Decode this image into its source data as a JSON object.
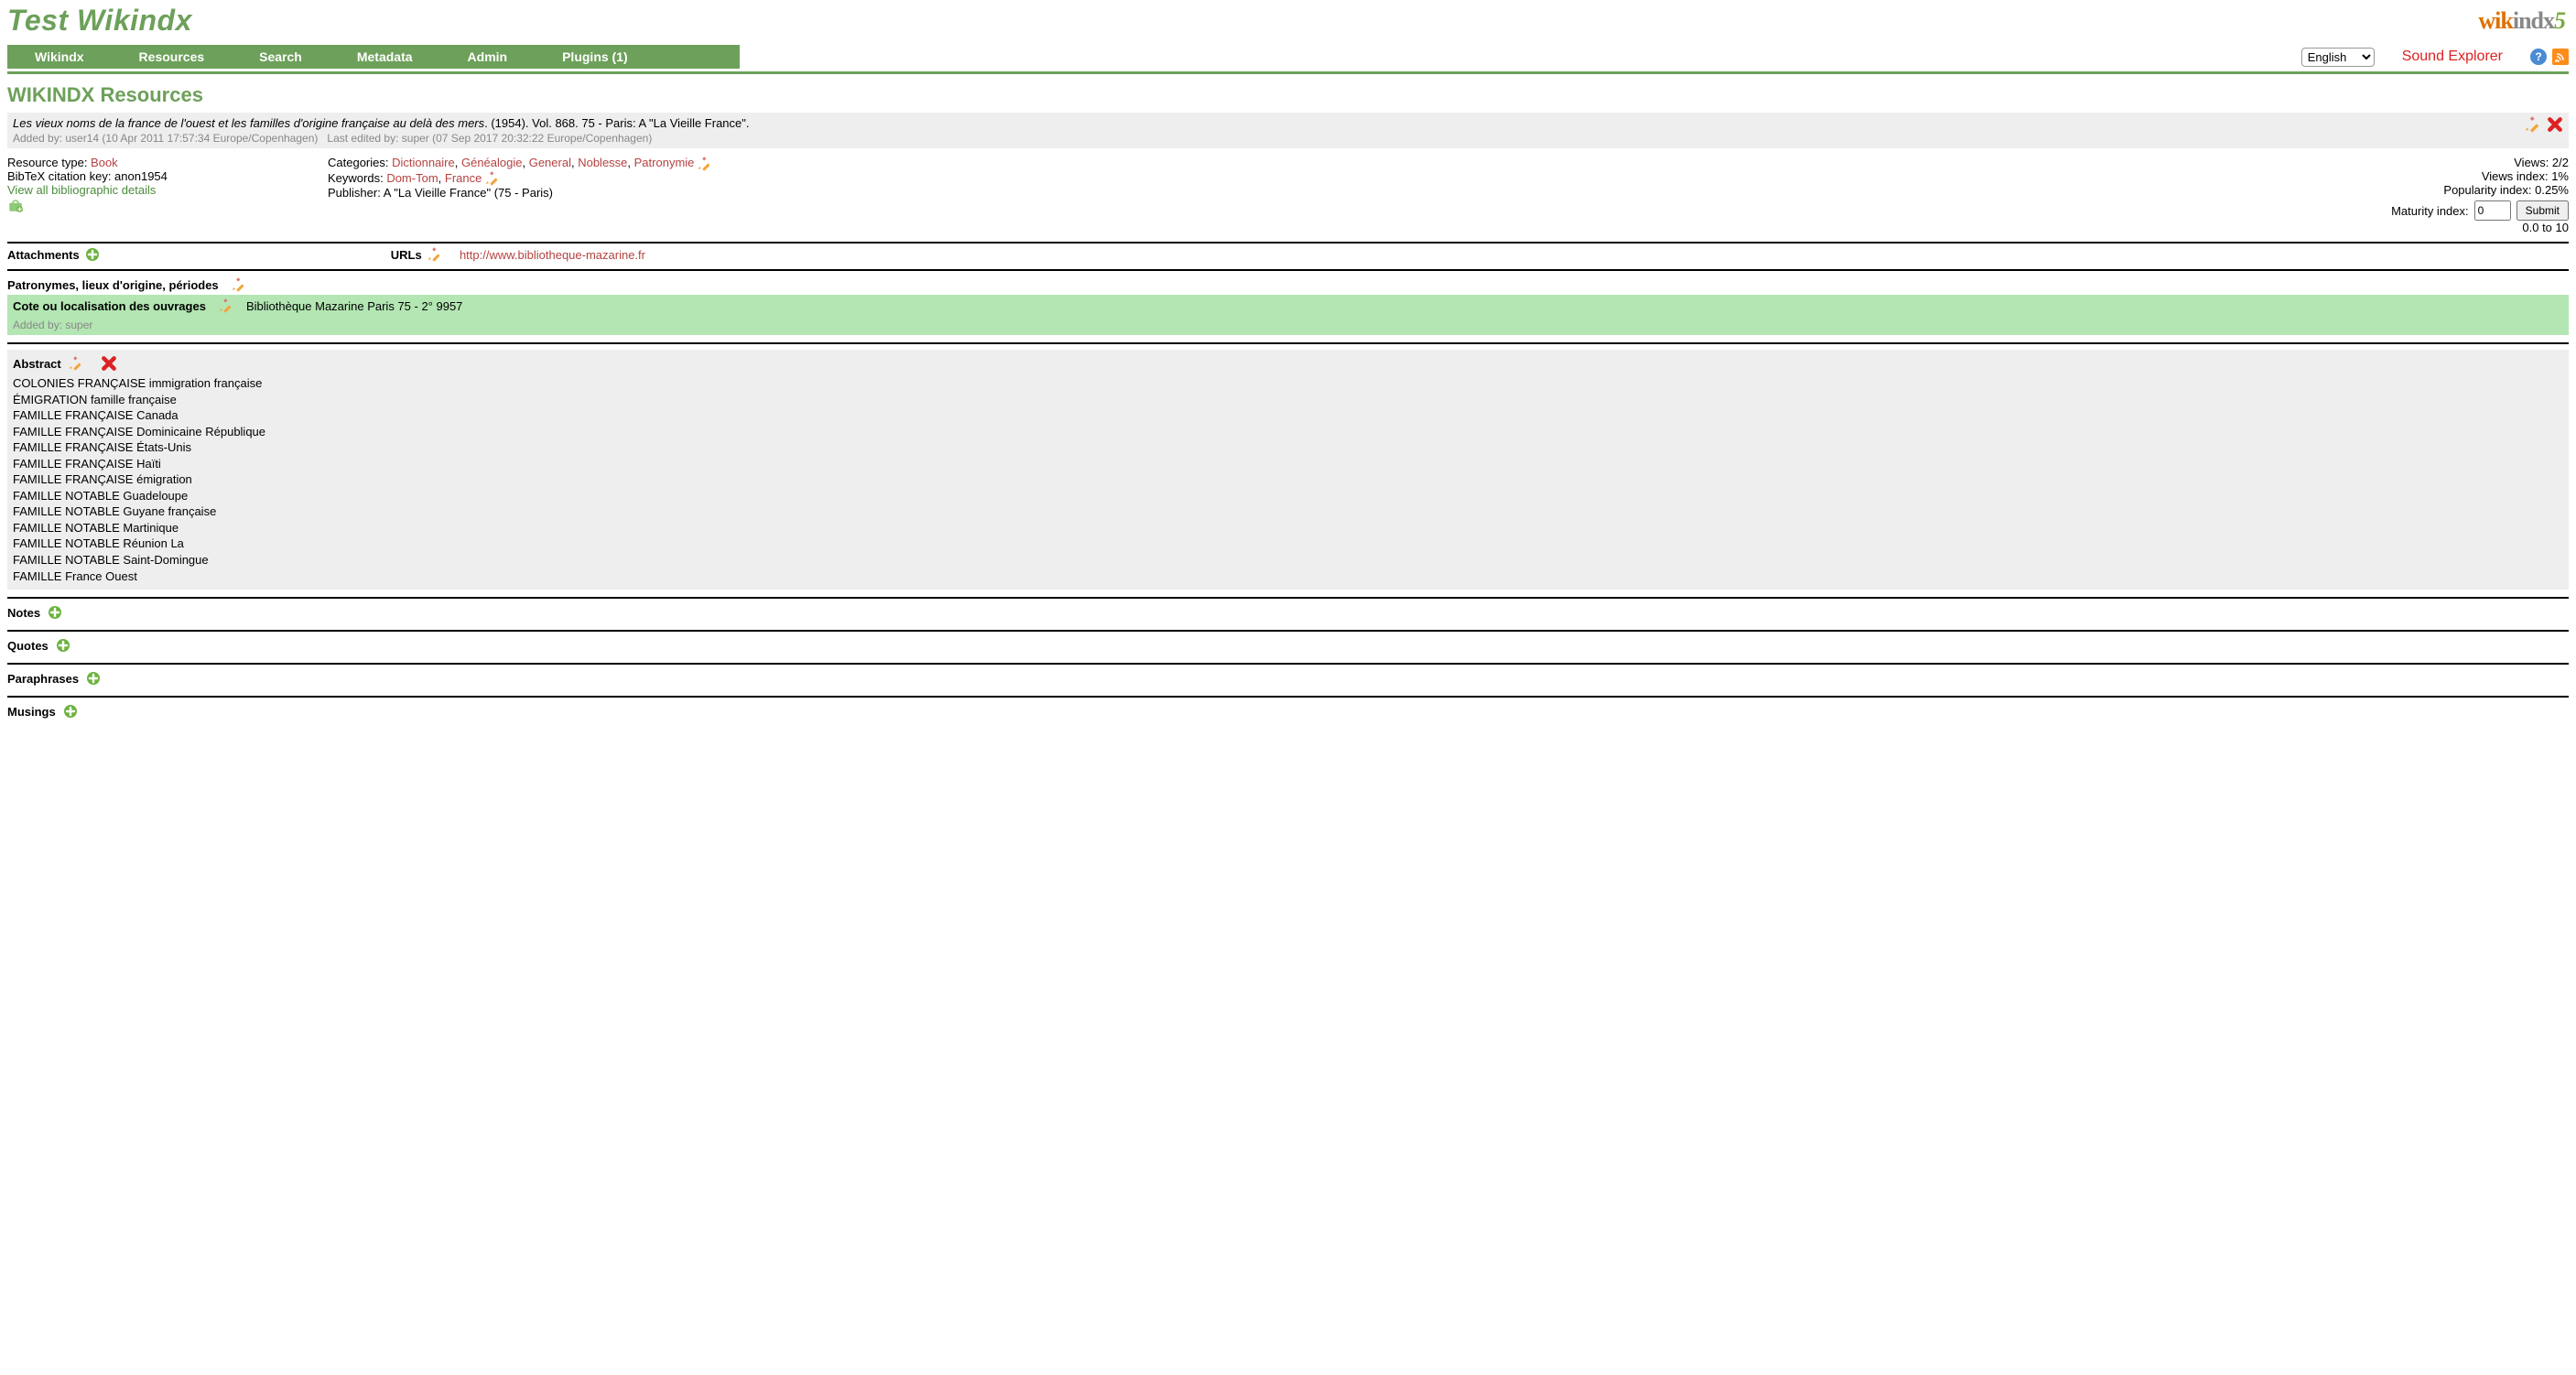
{
  "site_title": "Test Wikindx",
  "logo": {
    "part1": "wik",
    "part2": "indx",
    "part3": "5"
  },
  "menu": [
    "Wikindx",
    "Resources",
    "Search",
    "Metadata",
    "Admin",
    "Plugins (1)"
  ],
  "language_selected": "English",
  "sound_explorer": "Sound Explorer",
  "page_heading": "WIKINDX Resources",
  "citation": {
    "title": "Les vieux noms de la france de l'ouest et les familles d'origine française au delà des mers",
    "rest": ". (1954). Vol. 868. 75 - Paris: A \"La Vieille France\".",
    "added_by": "Added by: user14 (10 Apr 2011 17:57:34 Europe/Copenhagen)",
    "last_edited": "Last edited by: super (07 Sep 2017 20:32:22 Europe/Copenhagen)"
  },
  "details": {
    "resource_type_label": "Resource type: ",
    "resource_type": "Book",
    "bibtex_label": "BibTeX citation key: anon1954",
    "view_all": "View all bibliographic details",
    "categories_label": "Categories: ",
    "categories": [
      "Dictionnaire",
      "Généalogie",
      "General",
      "Noblesse",
      "Patronymie"
    ],
    "keywords_label": "Keywords: ",
    "keywords": [
      "Dom-Tom",
      "France"
    ],
    "publisher_label": "Publisher: A \"La Vieille France\" (75 - Paris)",
    "views": "Views: 2/2",
    "views_index": "Views index: 1%",
    "popularity": "Popularity index: 0.25%",
    "maturity_label": "Maturity index:",
    "maturity_value": "0",
    "submit": "Submit",
    "maturity_range": "0.0 to 10"
  },
  "attachments_label": "Attachments",
  "urls_label": "URLs",
  "url": "http://www.bibliotheque-mazarine.fr",
  "patro_label": "Patronymes, lieux d'origine, périodes",
  "cote_label": "Cote ou localisation des ouvrages",
  "cote_value": "Bibliothèque Mazarine Paris 75 - 2° 9957",
  "cote_added_by": "Added by: super",
  "abstract_label": "Abstract",
  "abstract_lines": [
    "COLONIES FRANÇAISE immigration française",
    "ÉMIGRATION famille française",
    "FAMILLE FRANÇAISE Canada",
    "FAMILLE FRANÇAISE Dominicaine République",
    "FAMILLE FRANÇAISE États-Unis",
    "FAMILLE FRANÇAISE Haïti",
    "FAMILLE FRANÇAISE émigration",
    "FAMILLE NOTABLE Guadeloupe",
    "FAMILLE NOTABLE Guyane française",
    "FAMILLE NOTABLE Martinique",
    "FAMILLE NOTABLE Réunion La",
    "FAMILLE NOTABLE Saint-Domingue",
    "FAMILLE France Ouest"
  ],
  "sections": {
    "notes": "Notes",
    "quotes": "Quotes",
    "paraphrases": "Paraphrases",
    "musings": "Musings"
  }
}
